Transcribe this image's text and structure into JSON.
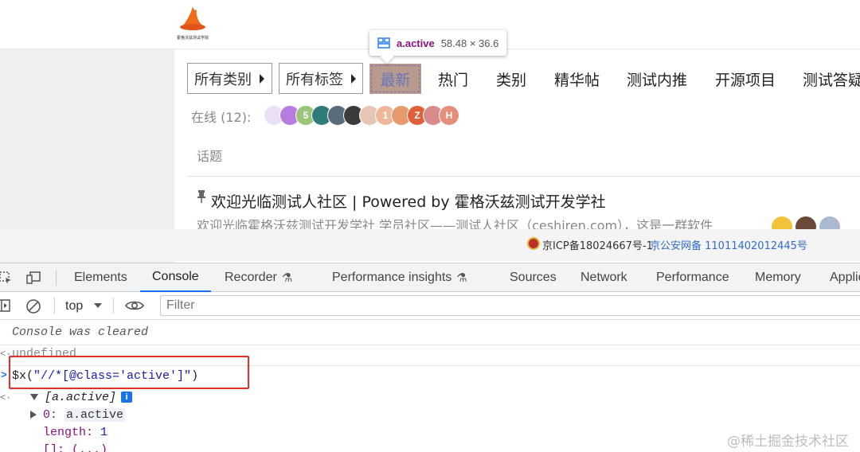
{
  "site": {
    "logo_caption": "霍格沃兹测试学院",
    "dropdowns": {
      "category": "所有类别",
      "tag": "所有标签"
    },
    "nav_tabs": [
      "最新",
      "热门",
      "类别",
      "精华帖",
      "测试内推",
      "开源项目",
      "测试答疑"
    ],
    "online_label": "在线 (12):",
    "avatar_letters": [
      "",
      "",
      "5",
      "",
      "",
      "",
      "",
      "1",
      "",
      "Z",
      "",
      "H"
    ],
    "topics_header": "话题",
    "topic": {
      "title": "欢迎光临测试人社区 | Powered by 霍格沃兹测试开发学社",
      "excerpt": "欢迎光临霍格沃兹测试开发学社 学员社区——测试人社区（ceshiren.com），这是一群软件"
    },
    "footer": {
      "icp": "京ICP备18024667号-1",
      "psb": "京公安网备 11011402012445号"
    }
  },
  "inspect_tooltip": {
    "tag": "a.active",
    "dims": "58.48 × 36.6"
  },
  "devtools": {
    "tabs": [
      "Elements",
      "Console",
      "Recorder",
      "Performance insights",
      "Sources",
      "Network",
      "Performance",
      "Memory",
      "Application"
    ],
    "active_tab": "Console",
    "context": "top",
    "filter_placeholder": "Filter",
    "console": {
      "cleared": "Console was cleared",
      "undefined_text": "undefined",
      "command_prefix": "$x(",
      "command_string": "\"//*[@class='active']\"",
      "command_suffix": ")",
      "result_summary": "[a.active]",
      "item_index": "0:",
      "item_value": "a.active",
      "length_key": "length:",
      "length_value": "1",
      "proto": "[]: (...)"
    }
  },
  "watermark": "@稀土掘金技术社区",
  "colors": {
    "active_nav_bg": "#c7a77a",
    "devtools_accent": "#1a73e8",
    "highlight_box": "#e0302c"
  }
}
